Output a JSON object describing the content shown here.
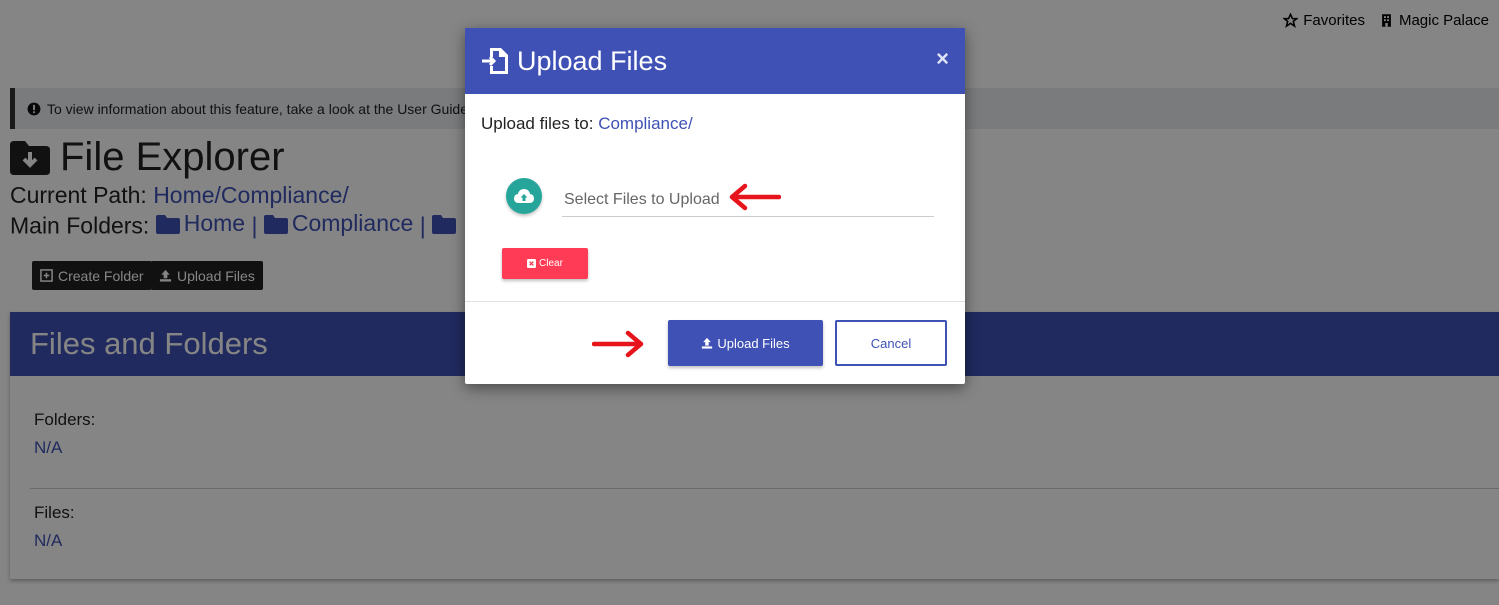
{
  "topnav": {
    "favorites": "Favorites",
    "location": "Magic Palace"
  },
  "info_note": {
    "text": "To view information about this feature, take a look at the User Guide"
  },
  "page": {
    "title": "File Explorer",
    "current_path_label": "Current Path:",
    "current_path_value": "Home/Compliance/",
    "main_folders_label": "Main Folders:",
    "main_folders": [
      "Home",
      "Compliance"
    ],
    "separator": "|"
  },
  "toolbar": {
    "create_folder": "Create Folder",
    "upload_files": "Upload Files"
  },
  "files_card": {
    "header": "Files and Folders",
    "folders_label": "Folders:",
    "folders_value": "N/A",
    "files_label": "Files:",
    "files_value": "N/A"
  },
  "modal": {
    "title": "Upload Files",
    "close": "×",
    "upload_to_label": "Upload files to:",
    "upload_to_path": "Compliance/",
    "file_input_placeholder": "Select Files to Upload",
    "clear_label": "Clear",
    "upload_label": "Upload Files",
    "cancel_label": "Cancel"
  },
  "colors": {
    "primary": "#3f51b5",
    "teal": "#26a69a",
    "danger": "#ff3b55",
    "annotation_arrow": "#e8141b"
  }
}
